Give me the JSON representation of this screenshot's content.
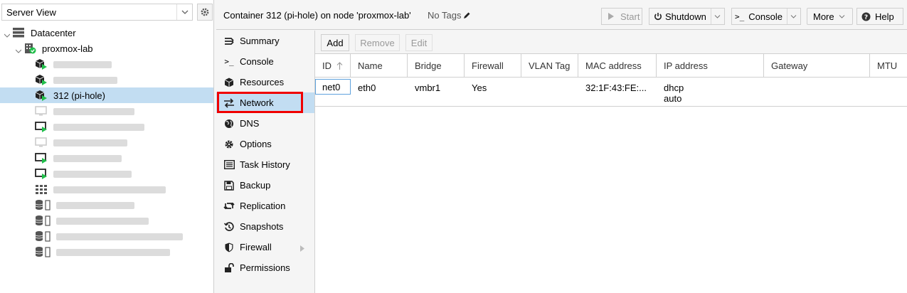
{
  "tree": {
    "view_select": "Server View",
    "datacenter": "Datacenter",
    "node": "proxmox-lab",
    "selected_ct": "312 (pi-hole)"
  },
  "topbar": {
    "title": "Container 312 (pi-hole) on node 'proxmox-lab'",
    "tags": "No Tags",
    "start": "Start",
    "shutdown": "Shutdown",
    "console": "Console",
    "more": "More",
    "help": "Help"
  },
  "menu": {
    "items": [
      {
        "label": "Summary",
        "icon": "summary-icon"
      },
      {
        "label": "Console",
        "icon": "terminal-icon"
      },
      {
        "label": "Resources",
        "icon": "cube-icon"
      },
      {
        "label": "Network",
        "icon": "exchange-icon"
      },
      {
        "label": "DNS",
        "icon": "globe-icon"
      },
      {
        "label": "Options",
        "icon": "gear-icon"
      },
      {
        "label": "Task History",
        "icon": "list-icon"
      },
      {
        "label": "Backup",
        "icon": "floppy-icon"
      },
      {
        "label": "Replication",
        "icon": "retweet-icon"
      },
      {
        "label": "Snapshots",
        "icon": "history-icon"
      },
      {
        "label": "Firewall",
        "icon": "shield-icon"
      },
      {
        "label": "Permissions",
        "icon": "unlock-icon"
      }
    ],
    "active": "Network"
  },
  "content": {
    "toolbar": {
      "add": "Add",
      "remove": "Remove",
      "edit": "Edit"
    },
    "columns": [
      "ID",
      "Name",
      "Bridge",
      "Firewall",
      "VLAN Tag",
      "MAC address",
      "IP address",
      "Gateway",
      "MTU"
    ],
    "rows": [
      {
        "id": "net0",
        "name": "eth0",
        "bridge": "vmbr1",
        "firewall": "Yes",
        "vlan": "",
        "mac": "32:1F:43:FE:...",
        "ip": "dhcp",
        "ip6": "auto",
        "gateway": "",
        "mtu": ""
      }
    ]
  },
  "colors": {
    "selection": "#c2ddf2",
    "highlight": "#f00000",
    "running": "#21bf4b"
  }
}
